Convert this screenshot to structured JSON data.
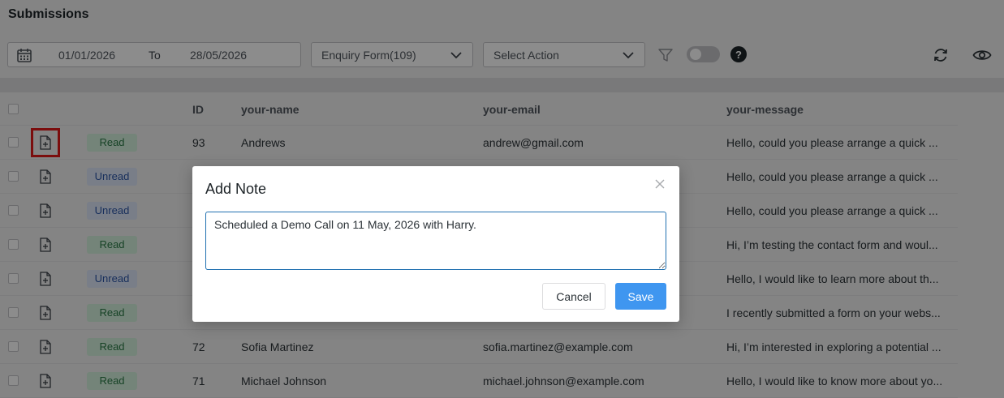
{
  "page": {
    "title": "Submissions"
  },
  "toolbar": {
    "date_from": "01/01/2026",
    "date_to_label": "To",
    "date_to": "28/05/2026",
    "form_select": "Enquiry Form(109)",
    "action_select": "Select Action",
    "icons": [
      "calendar-icon",
      "chevron-down-icon",
      "filter-icon",
      "toggle-switch",
      "help-icon",
      "refresh-icon",
      "eye-icon"
    ]
  },
  "table": {
    "headers": {
      "id": "ID",
      "name": "your-name",
      "email": "your-email",
      "message": "your-message"
    },
    "rows": [
      {
        "status": "Read",
        "id": "93",
        "name": "Andrews",
        "email": "andrew@gmail.com",
        "message": "Hello, could you please arrange a quick ..."
      },
      {
        "status": "Unread",
        "id": "",
        "name": "",
        "email": "",
        "message": "Hello, could you please arrange a quick ..."
      },
      {
        "status": "Unread",
        "id": "",
        "name": "",
        "email": "",
        "message": "Hello, could you please arrange a quick ..."
      },
      {
        "status": "Read",
        "id": "",
        "name": "",
        "email": "",
        "message": "Hi, I’m testing the contact form and woul..."
      },
      {
        "status": "Unread",
        "id": "",
        "name": "",
        "email": "",
        "message": "Hello, I would like to learn more about th..."
      },
      {
        "status": "Read",
        "id": "",
        "name": "",
        "email": "",
        "message": "I recently submitted a form on your webs..."
      },
      {
        "status": "Read",
        "id": "72",
        "name": "Sofia Martinez",
        "email": "sofia.martinez@example.com",
        "message": "Hi, I’m interested in exploring a potential ..."
      },
      {
        "status": "Read",
        "id": "71",
        "name": "Michael Johnson",
        "email": "michael.johnson@example.com",
        "message": "Hello, I would like to know more about yo..."
      }
    ]
  },
  "modal": {
    "title": "Add Note",
    "note_value": "Scheduled a Demo Call on 11 May, 2026 with Harry.",
    "cancel_label": "Cancel",
    "save_label": "Save"
  },
  "colors": {
    "save_button": "#3f96f0",
    "read_badge": "#d4f0dc",
    "unread_badge": "#dde6f7",
    "highlight": "#e11818"
  }
}
